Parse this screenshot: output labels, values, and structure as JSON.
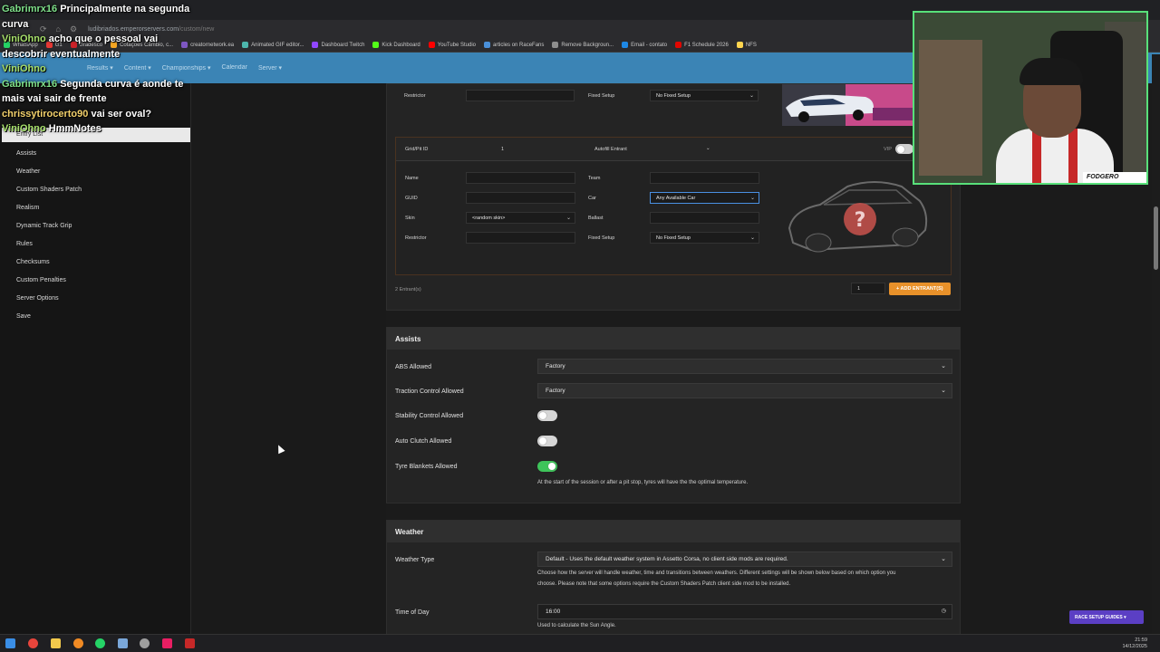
{
  "browser": {
    "url_host": "ludibriados.emperorservers.com",
    "url_path": "/custom/new",
    "bookmarks": [
      "WhatsApp",
      "G1",
      "Bradesco",
      "Cotações Câmbio, c...",
      "creatornetwork.ea",
      "Animated GIF editor...",
      "Dashboard Twitch",
      "Kick Dashboard",
      "YouTube Studio",
      "articles on RaceFans",
      "Remove Backgroun...",
      "Email - contato",
      "F1 Schedule 2026",
      "NFS"
    ],
    "bookmark_colors": [
      "#25d366",
      "#e53935",
      "#cc2229",
      "#f5a623",
      "#7e57c2",
      "#4db6ac",
      "#9146ff",
      "#53fc18",
      "#ff0000",
      "#4a90d9",
      "#8e8e8e",
      "#1e88e5",
      "#e10600",
      "#ffd54f"
    ]
  },
  "appnav": {
    "links": [
      "Results ▾",
      "Content ▾",
      "Championships ▾",
      "Calendar",
      "Server ▾"
    ]
  },
  "sidebar": {
    "active": "Entry List",
    "items": [
      "Assists",
      "Weather",
      "Custom Shaders Patch",
      "Realism",
      "Dynamic Track Grip",
      "Rules",
      "Checksums",
      "Custom Penalties",
      "Server Options",
      "Save"
    ]
  },
  "entry_top": {
    "restrictor_label": "Restrictor",
    "fixed_setup_label": "Fixed Setup",
    "fixed_setup_value": "No Fixed Setup"
  },
  "entrant": {
    "grid_label": "Grid/Pit ID",
    "grid_value": "1",
    "autofill_value": "Autofill Entrant",
    "vip_label": "VIP",
    "name_label": "Name",
    "team_label": "Team",
    "guid_label": "GUID",
    "car_label": "Car",
    "car_value": "Any Available Car",
    "skin_label": "Skin",
    "skin_value": "<random skin>",
    "ballast_label": "Ballast",
    "restrictor_label": "Restrictor",
    "fixed_setup_label": "Fixed Setup",
    "fixed_setup_value": "No Fixed Setup",
    "unknown_car_mark": "?"
  },
  "entrants_footer": {
    "count_text": "2 Entrant(s)",
    "qty_value": "1",
    "add_button": "+ ADD ENTRANT(S)"
  },
  "assists": {
    "title": "Assists",
    "abs_label": "ABS Allowed",
    "abs_value": "Factory",
    "tc_label": "Traction Control Allowed",
    "tc_value": "Factory",
    "stability_label": "Stability Control Allowed",
    "stability_on": false,
    "autoclutch_label": "Auto Clutch Allowed",
    "autoclutch_on": false,
    "blankets_label": "Tyre Blankets Allowed",
    "blankets_on": true,
    "blankets_help": "At the start of the session or after a pit stop, tyres will have the the optimal temperature."
  },
  "weather": {
    "title": "Weather",
    "type_label": "Weather Type",
    "type_value": "Default - Uses the default weather system in Assetto Corsa, no client side mods are required.",
    "type_help_1": "Choose how the server will handle weather, time and transitions between weathers. Different settings will be shown below based on which option you",
    "type_help_2": "choose. Please note that some options require the Custom Shaders Patch client side mod to be installed.",
    "time_label": "Time of Day",
    "time_value": "16:00",
    "time_help": "Used to calculate the Sun Angle."
  },
  "chat": [
    {
      "user": "Gabrimrx16",
      "msg": "Principalmente na segunda curva"
    },
    {
      "user": "ViniOhno",
      "msg": "acho que o pessoal vai descobrir eventualmente"
    },
    {
      "user": "ViniOhno",
      "msg": ""
    },
    {
      "user": "Gabrimrx16",
      "msg": "Segunda curva é aonde te mais vai sair de frente"
    },
    {
      "user": "chrissytirocerto90",
      "msg": "vai ser oval?"
    },
    {
      "user": "ViniOhno",
      "msg": "HmmNotes"
    }
  ],
  "webcam": {
    "logo_text": "FODGERO"
  },
  "race_guides": "RACE SETUP GUIDES ▾",
  "taskbar": {
    "time": "21:59",
    "date": "14/12/2025"
  }
}
